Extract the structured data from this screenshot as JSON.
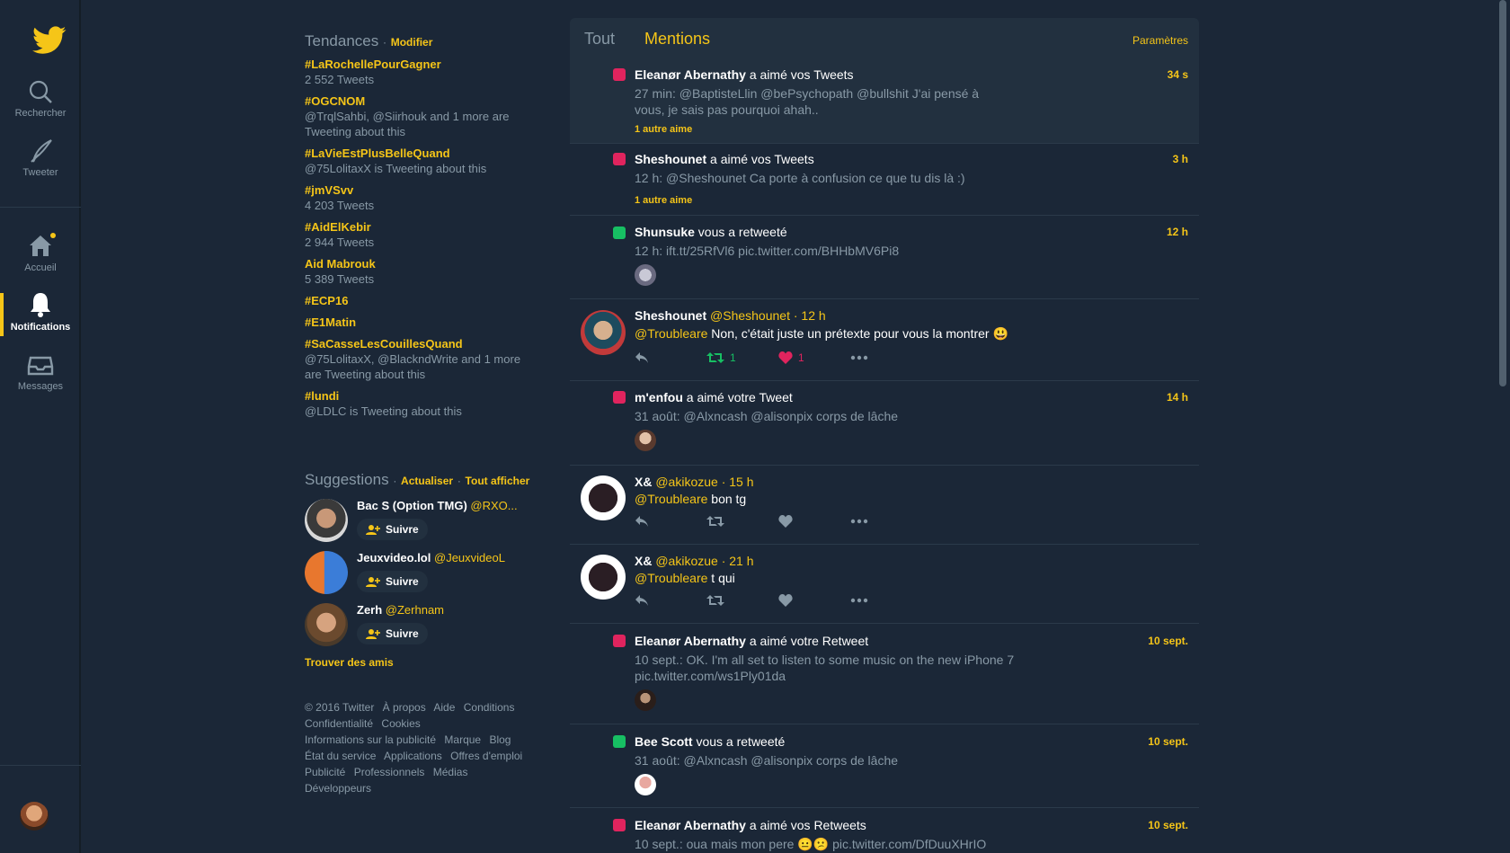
{
  "nav": {
    "items": [
      {
        "label": "Rechercher"
      },
      {
        "label": "Tweeter"
      },
      {
        "label": "Accueil"
      },
      {
        "label": "Notifications"
      },
      {
        "label": "Messages"
      }
    ]
  },
  "trends": {
    "title": "Tendances",
    "edit_label": "Modifier",
    "items": [
      {
        "name": "#LaRochellePourGagner",
        "meta": "2 552 Tweets"
      },
      {
        "name": "#OGCNOM",
        "meta": "@TrqlSahbi, @Siirhouk and 1 more are Tweeting about this"
      },
      {
        "name": "#LaVieEstPlusBelleQuand",
        "meta": "@75LolitaxX is Tweeting about this"
      },
      {
        "name": "#jmVSvv",
        "meta": "4 203 Tweets"
      },
      {
        "name": "#AidElKebir",
        "meta": "2 944 Tweets"
      },
      {
        "name": "Aid Mabrouk",
        "meta": "5 389 Tweets"
      },
      {
        "name": "#ECP16",
        "meta": ""
      },
      {
        "name": "#E1Matin",
        "meta": ""
      },
      {
        "name": "#SaCasseLesCouillesQuand",
        "meta": "@75LolitaxX, @BlackndWrite and 1 more are Tweeting about this"
      },
      {
        "name": "#lundi",
        "meta": "@LDLC is Tweeting about this"
      }
    ]
  },
  "suggestions": {
    "title": "Suggestions",
    "refresh_label": "Actualiser",
    "view_all_label": "Tout afficher",
    "follow_label": "Suivre",
    "items": [
      {
        "name": "Bac S (Option TMG)",
        "handle": "@RXO..."
      },
      {
        "name": "Jeuxvideo.lol",
        "handle": "@JeuxvideoL"
      },
      {
        "name": "Zerh",
        "handle": "@Zerhnam"
      }
    ],
    "find_friends": "Trouver des amis"
  },
  "footer": {
    "links": [
      "© 2016 Twitter",
      "À propos",
      "Aide",
      "Conditions",
      "Confidentialité",
      "Cookies",
      "Informations sur la publicité",
      "Marque",
      "Blog",
      "État du service",
      "Applications",
      "Offres d'emploi",
      "Publicité",
      "Professionnels",
      "Médias",
      "Développeurs"
    ]
  },
  "panel": {
    "tab_all": "Tout",
    "tab_mentions": "Mentions",
    "settings": "Paramètres",
    "notifications": [
      {
        "type": "like",
        "user": "Eleanør Abernathy",
        "action": " a aimé vos Tweets",
        "time": "34 s",
        "body": "27 min: @BaptisteLlin @bePsychopath @bullshit J'ai pensé à vous, je sais pas pourquoi ahah..",
        "sub": "1 autre aime"
      },
      {
        "type": "like",
        "user": "Sheshounet",
        "action": " a aimé vos Tweets",
        "time": "3 h",
        "body": "12 h: @Sheshounet Ca porte à confusion ce que tu dis là :)",
        "sub": "1 autre aime"
      },
      {
        "type": "retweet",
        "user": "Shunsuke",
        "action": " vous a retweeté",
        "time": "12 h",
        "body": "12 h: ift.tt/25RfVl6 pic.twitter.com/BHHbMV6Pi8"
      },
      {
        "type": "tweet",
        "user": "Sheshounet",
        "handle": "@Sheshounet",
        "time": "· 12 h",
        "mention": "@Troubleare",
        "text": " Non, c'était juste un prétexte pour vous la montrer 😃",
        "retweets": "1",
        "likes": "1"
      },
      {
        "type": "like",
        "user": "m'enfou",
        "action": " a aimé votre Tweet",
        "time": "14 h",
        "body": "31 août: @Alxncash @alisonpix corps de lâche"
      },
      {
        "type": "tweet",
        "user": "X&",
        "handle": "@akikozue",
        "time": "· 15 h",
        "mention": "@Troubleare",
        "text": " bon tg"
      },
      {
        "type": "tweet",
        "user": "X&",
        "handle": "@akikozue",
        "time": "· 21 h",
        "mention": "@Troubleare",
        "text": " t qui"
      },
      {
        "type": "like",
        "user": "Eleanør Abernathy",
        "action": " a aimé votre Retweet",
        "time": "10 sept.",
        "body": "10 sept.: OK. I'm all set to listen to some music on the new iPhone 7 pic.twitter.com/ws1Ply01da"
      },
      {
        "type": "retweet",
        "user": "Bee Scott",
        "action": " vous a retweeté",
        "time": "10 sept.",
        "body": "31 août: @Alxncash @alisonpix corps de lâche"
      },
      {
        "type": "like",
        "user": "Eleanør Abernathy",
        "action": " a aimé vos Retweets",
        "time": "10 sept.",
        "body": "10 sept.: oua mais mon pere 😐😕 pic.twitter.com/DfDuuXHrIO"
      }
    ]
  },
  "colors": {
    "accent": "#f5c518",
    "background": "#1b2737",
    "card": "#22303f",
    "like": "#e0245e",
    "retweet": "#17bf63"
  }
}
